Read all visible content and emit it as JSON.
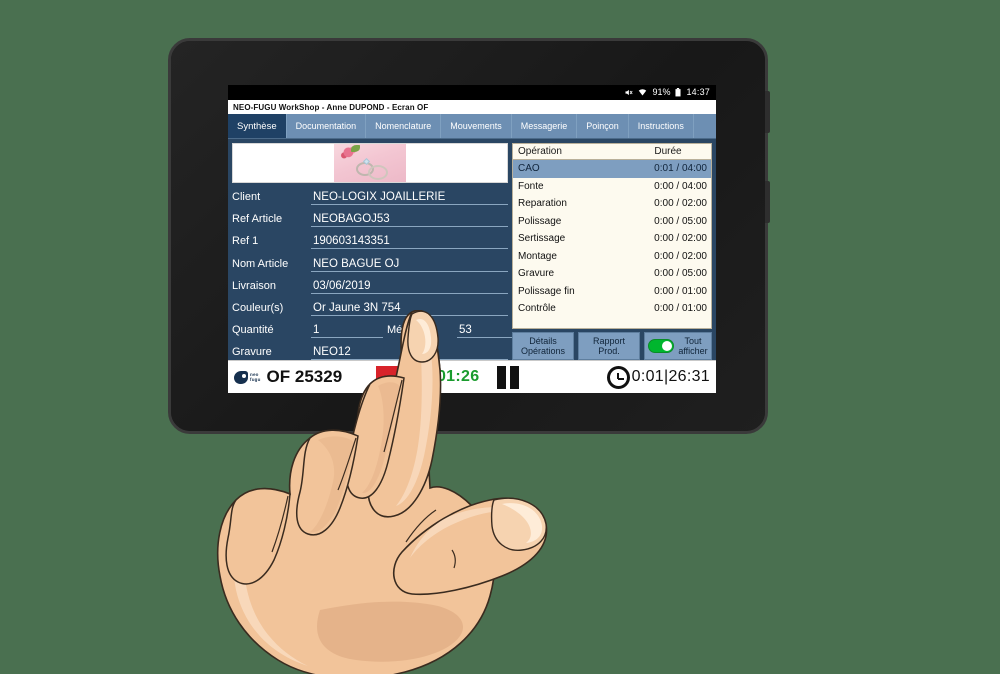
{
  "android_status": {
    "icons": [
      "mute-icon",
      "wifi-icon"
    ],
    "battery_percent": "91%",
    "time": "14:37"
  },
  "app": {
    "title": "NEO-FUGU WorkShop - Anne DUPOND - Ecran OF"
  },
  "tabs": [
    {
      "label": "Synthèse",
      "active": true
    },
    {
      "label": "Documentation",
      "active": false
    },
    {
      "label": "Nomenclature",
      "active": false
    },
    {
      "label": "Mouvements",
      "active": false
    },
    {
      "label": "Messagerie",
      "active": false
    },
    {
      "label": "Poinçon",
      "active": false
    },
    {
      "label": "Instructions",
      "active": false
    }
  ],
  "details": {
    "photo_alt": "wedding-rings-photo",
    "fields": [
      {
        "label": "Client",
        "value": "NEO-LOGIX JOAILLERIE"
      },
      {
        "label": "Ref Article",
        "value": "NEOBAGOJ53"
      },
      {
        "label": "Ref 1",
        "value": "190603143351"
      },
      {
        "label": "Nom Article",
        "value": "NEO BAGUE OJ"
      },
      {
        "label": "Livraison",
        "value": "03/06/2019"
      },
      {
        "label": "Couleur(s)",
        "value": "Or Jaune 3N 754"
      }
    ],
    "quantity_label": "Quantité",
    "quantity_value": "1",
    "metric_label": "Métrique",
    "metric_value": "53",
    "engraving_label": "Gravure",
    "engraving_value": "NEO12"
  },
  "operations": {
    "headers": {
      "operation": "Opération",
      "duration": "Durée"
    },
    "rows": [
      {
        "operation": "CAO",
        "duration": "0:01 / 04:00",
        "selected": true
      },
      {
        "operation": "Fonte",
        "duration": "0:00 / 04:00",
        "selected": false
      },
      {
        "operation": "Reparation",
        "duration": "0:00 / 02:00",
        "selected": false
      },
      {
        "operation": "Polissage",
        "duration": "0:00 / 05:00",
        "selected": false
      },
      {
        "operation": "Sertissage",
        "duration": "0:00 / 02:00",
        "selected": false
      },
      {
        "operation": "Montage",
        "duration": "0:00 / 02:00",
        "selected": false
      },
      {
        "operation": "Gravure",
        "duration": "0:00 / 05:00",
        "selected": false
      },
      {
        "operation": "Polissage fin",
        "duration": "0:00 / 01:00",
        "selected": false
      },
      {
        "operation": "Contrôle",
        "duration": "0:00 / 01:00",
        "selected": false
      }
    ],
    "buttons": {
      "details_line1": "Détails",
      "details_line2": "Opérations",
      "report": "Rapport Prod.",
      "show_all_line1": "Tout",
      "show_all_line2": "afficher",
      "show_all_toggle_on": true
    }
  },
  "bottom_bar": {
    "brand_line1": "neo",
    "brand_line2": "fugu",
    "of_number": "OF 25329",
    "stop_button": "stop-button",
    "running_timer": "0:01:26",
    "pause_button": "pause-button",
    "clock_icon": "clock-icon",
    "total_timer": "0:01|26:31"
  },
  "colors": {
    "background": "#4a7050",
    "panel_blue": "#2a4663",
    "tab_active": "#1f4165",
    "tab_inactive": "#6d8fb3",
    "table_bg": "#fdfaef",
    "row_selected": "#7e9ec0",
    "toggle_green": "#00b62e",
    "timer_green": "#1a9c2e",
    "stop_red": "#d8232a"
  }
}
